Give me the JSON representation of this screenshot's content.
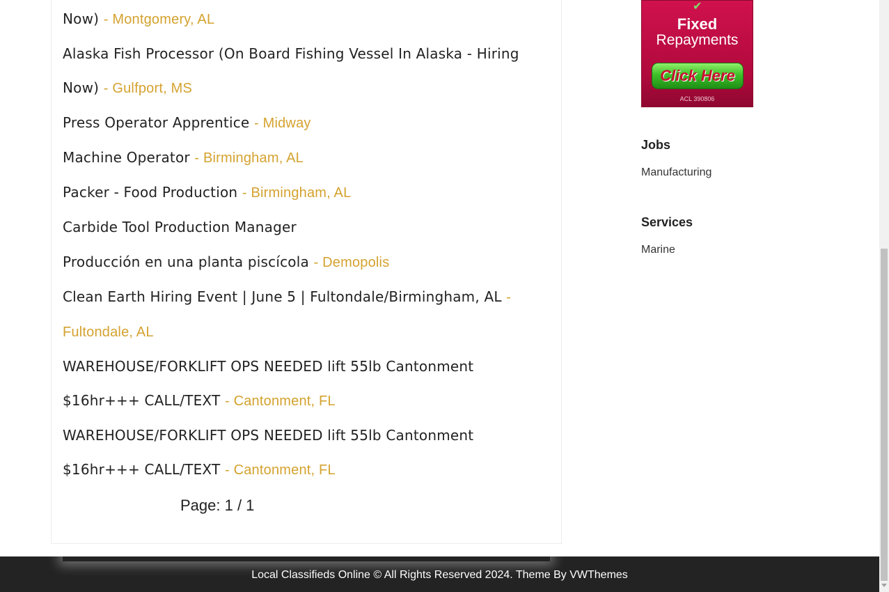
{
  "jobs": [
    {
      "title": "Now)",
      "location": "- Montgomery, AL"
    },
    {
      "title": "Alaska Fish Processor (On Board Fishing Vessel In Alaska - Hiring Now)",
      "location": "- Gulfport, MS"
    },
    {
      "title": "Press Operator Apprentice",
      "location": "- Midway"
    },
    {
      "title": "Machine Operator",
      "location": "- Birmingham, AL"
    },
    {
      "title": "Packer - Food Production",
      "location": "- Birmingham, AL"
    },
    {
      "title": "Carbide Tool Production Manager",
      "location": ""
    },
    {
      "title": "Producción en una planta piscícola",
      "location": "- Demopolis"
    },
    {
      "title": "Clean Earth Hiring Event | June 5 | Fultondale/Birmingham, AL",
      "location": "- Fultondale, AL"
    },
    {
      "title": "WAREHOUSE/FORKLIFT OPS NEEDED lift 55lb Cantonment $16hr+++ CALL/TEXT",
      "location": "- Cantonment, FL"
    },
    {
      "title": "WAREHOUSE/FORKLIFT OPS NEEDED lift 55lb Cantonment $16hr+++ CALL/TEXT",
      "location": "- Cantonment, FL"
    }
  ],
  "pagination": {
    "text": "Page: 1 / 1"
  },
  "ad": {
    "line1": "Fixed",
    "line2": "Repayments",
    "cta": "Click Here",
    "acl": "ACL 390806",
    "icon": "checkmark-icon"
  },
  "sidebar": {
    "jobs_title": "Jobs",
    "jobs_link": "Manufacturing",
    "services_title": "Services",
    "services_link": "Marine"
  },
  "footer": {
    "text": "Local Classifieds Online © All Rights Reserved 2024. Theme By VWThemes"
  },
  "colors": {
    "location": "#d4a22f",
    "footer_bg": "#232323",
    "ad_bg": "#c90f48",
    "cta_green": "#3fc02a"
  }
}
